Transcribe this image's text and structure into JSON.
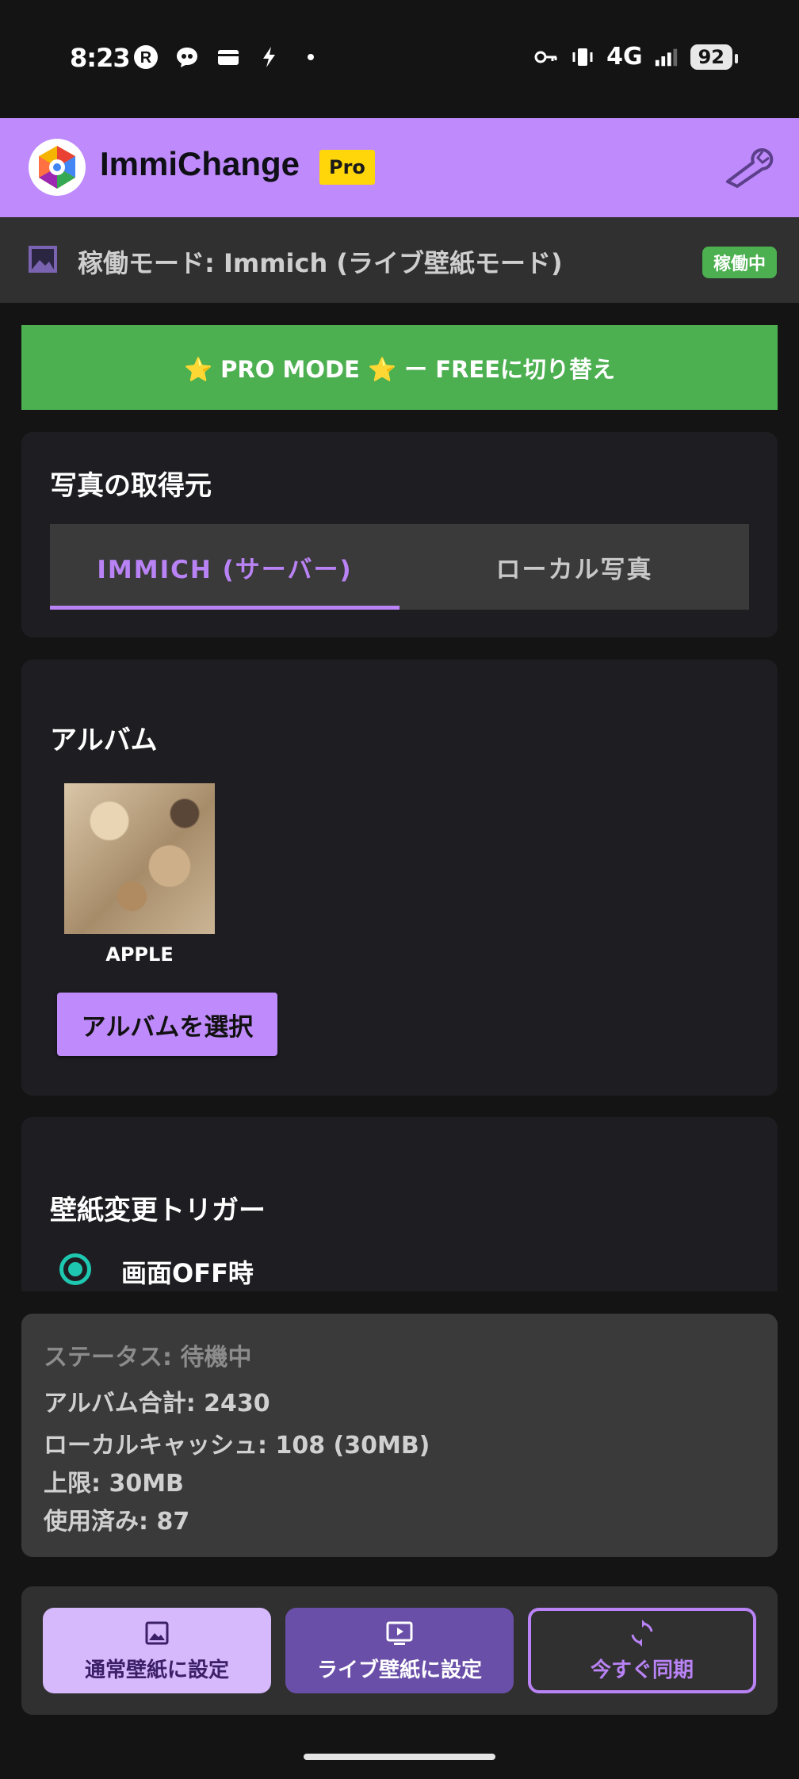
{
  "status_bar": {
    "time": "8:23",
    "network": "4G",
    "battery": "92"
  },
  "app_bar": {
    "title": "ImmiChange",
    "pro_badge": "Pro"
  },
  "mode_bar": {
    "text": "稼働モード: Immich (ライブ壁紙モード)",
    "badge": "稼働中"
  },
  "pro_mode_button": "⭐ PRO MODE ⭐ ー FREEに切り替え",
  "source": {
    "title": "写真の取得元",
    "tabs": [
      {
        "label": "IMMICH (サーバー)",
        "active": true
      },
      {
        "label": "ローカル写真",
        "active": false
      }
    ]
  },
  "album": {
    "title": "アルバム",
    "items": [
      {
        "name": "APPLE"
      }
    ],
    "select_button": "アルバムを選択"
  },
  "trigger": {
    "title": "壁紙変更トリガー",
    "options": [
      {
        "label": "画面OFF時",
        "selected": true
      }
    ]
  },
  "status": {
    "state": "ステータス: 待機中",
    "album_total": "アルバム合計: 2430",
    "local_cache": "ローカルキャッシュ: 108 (30MB)",
    "limit": "上限: 30MB",
    "used": "使用済み: 87"
  },
  "actions": {
    "set_normal": "通常壁紙に設定",
    "set_live": "ライブ壁紙に設定",
    "sync_now": "今すぐ同期"
  },
  "colors": {
    "accent": "#bf8afb",
    "green": "#4caf50",
    "pro_yellow": "#ffd60a",
    "radio": "#1ec8b0"
  }
}
